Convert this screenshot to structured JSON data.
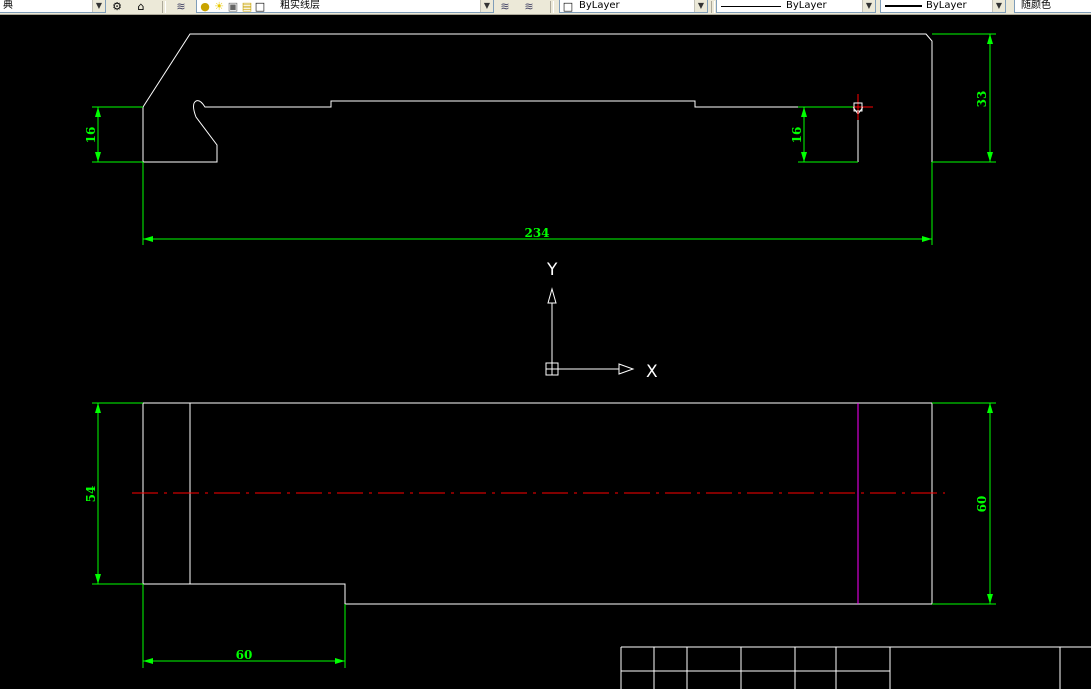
{
  "toolbar": {
    "text_style": "典",
    "layer_name": "粗实线层",
    "color": "ByLayer",
    "linetype": "ByLayer",
    "lineweight": "ByLayer",
    "plot_style": "随颜色"
  },
  "drawing": {
    "dimensions": {
      "top_left_height": "16",
      "top_right_height_small": "16",
      "top_right_height": "33",
      "top_width": "234",
      "bottom_left_height": "54",
      "bottom_right_height": "60",
      "bottom_step_width": "60"
    },
    "ucs": {
      "x_label": "X",
      "y_label": "Y"
    }
  },
  "colors": {
    "background": "#000000",
    "geometry": "#ffffff",
    "dimension": "#00ff00",
    "centerline": "#ff0000",
    "hidden_edge": "#ff00ff"
  }
}
